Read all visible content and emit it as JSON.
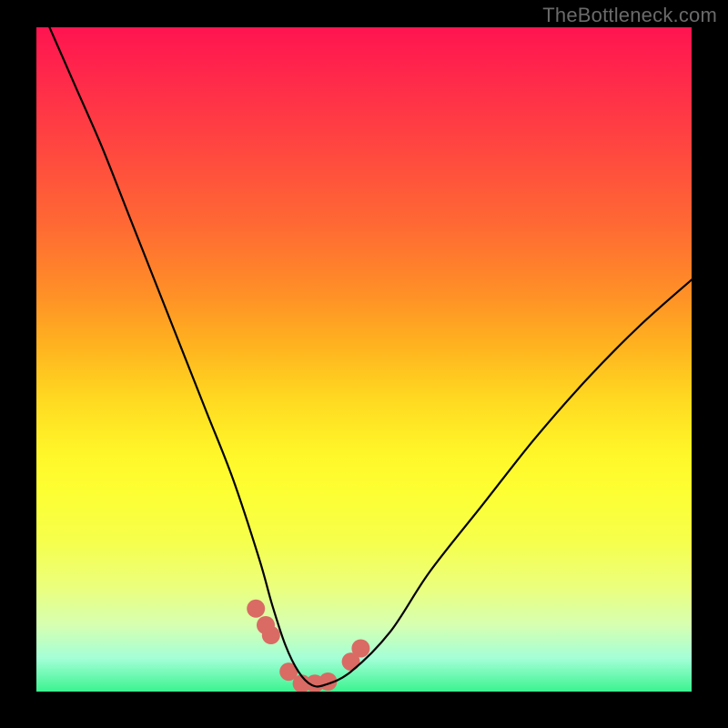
{
  "watermark": "TheBottleneck.com",
  "chart_data": {
    "type": "line",
    "title": "",
    "xlabel": "",
    "ylabel": "",
    "xlim": [
      0,
      100
    ],
    "ylim": [
      0,
      100
    ],
    "series": [
      {
        "name": "bottleneck-curve",
        "x": [
          2,
          6,
          10,
          14,
          18,
          22,
          26,
          30,
          34,
          36,
          38,
          40,
          42,
          44,
          48,
          54,
          60,
          68,
          76,
          84,
          92,
          100
        ],
        "y": [
          100,
          91,
          82,
          72,
          62,
          52,
          42,
          32,
          20,
          13,
          7,
          3,
          1,
          1,
          3,
          9,
          18,
          28,
          38,
          47,
          55,
          62
        ]
      }
    ],
    "markers": {
      "name": "highlight-dots",
      "x": [
        33.5,
        35.0,
        35.8,
        38.5,
        40.5,
        42.5,
        44.5,
        48.0,
        49.5
      ],
      "y": [
        12.5,
        10.0,
        8.5,
        3.0,
        1.2,
        1.2,
        1.5,
        4.5,
        6.5
      ],
      "color": "#d96b64",
      "radius": 10
    },
    "background": {
      "type": "vertical-gradient",
      "stops": [
        {
          "pos": 0.0,
          "color": "#ff1450"
        },
        {
          "pos": 0.3,
          "color": "#ff6a33"
        },
        {
          "pos": 0.56,
          "color": "#ffd921"
        },
        {
          "pos": 0.7,
          "color": "#fdff33"
        },
        {
          "pos": 0.9,
          "color": "#d6ffb1"
        },
        {
          "pos": 1.0,
          "color": "#3bf38f"
        }
      ]
    }
  }
}
